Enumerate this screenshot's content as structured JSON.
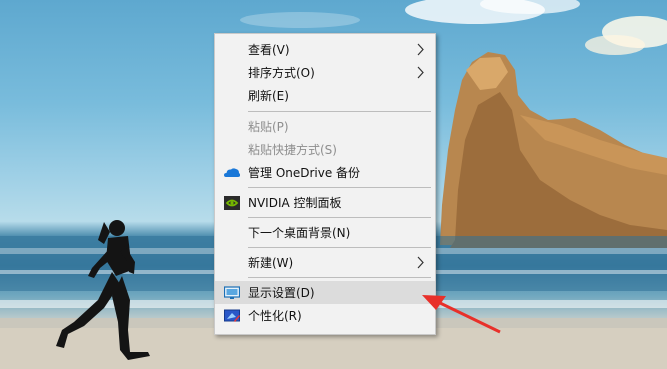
{
  "menu": {
    "view": "查看(V)",
    "sort": "排序方式(O)",
    "refresh": "刷新(E)",
    "paste": "粘贴(P)",
    "paste_shortcut": "粘贴快捷方式(S)",
    "onedrive": "管理 OneDrive 备份",
    "nvidia": "NVIDIA 控制面板",
    "next_bg": "下一个桌面背景(N)",
    "new": "新建(W)",
    "display": "显示设置(D)",
    "personalize": "个性化(R)"
  },
  "icons": [
    "onedrive-icon",
    "nvidia-icon",
    "display-settings-icon",
    "personalize-icon"
  ],
  "colors": {
    "menu_bg": "#f2f2f2",
    "hover_bg": "#dcdcdc",
    "arrow": "#e8302a",
    "disabled_text": "#8e8e8e"
  }
}
